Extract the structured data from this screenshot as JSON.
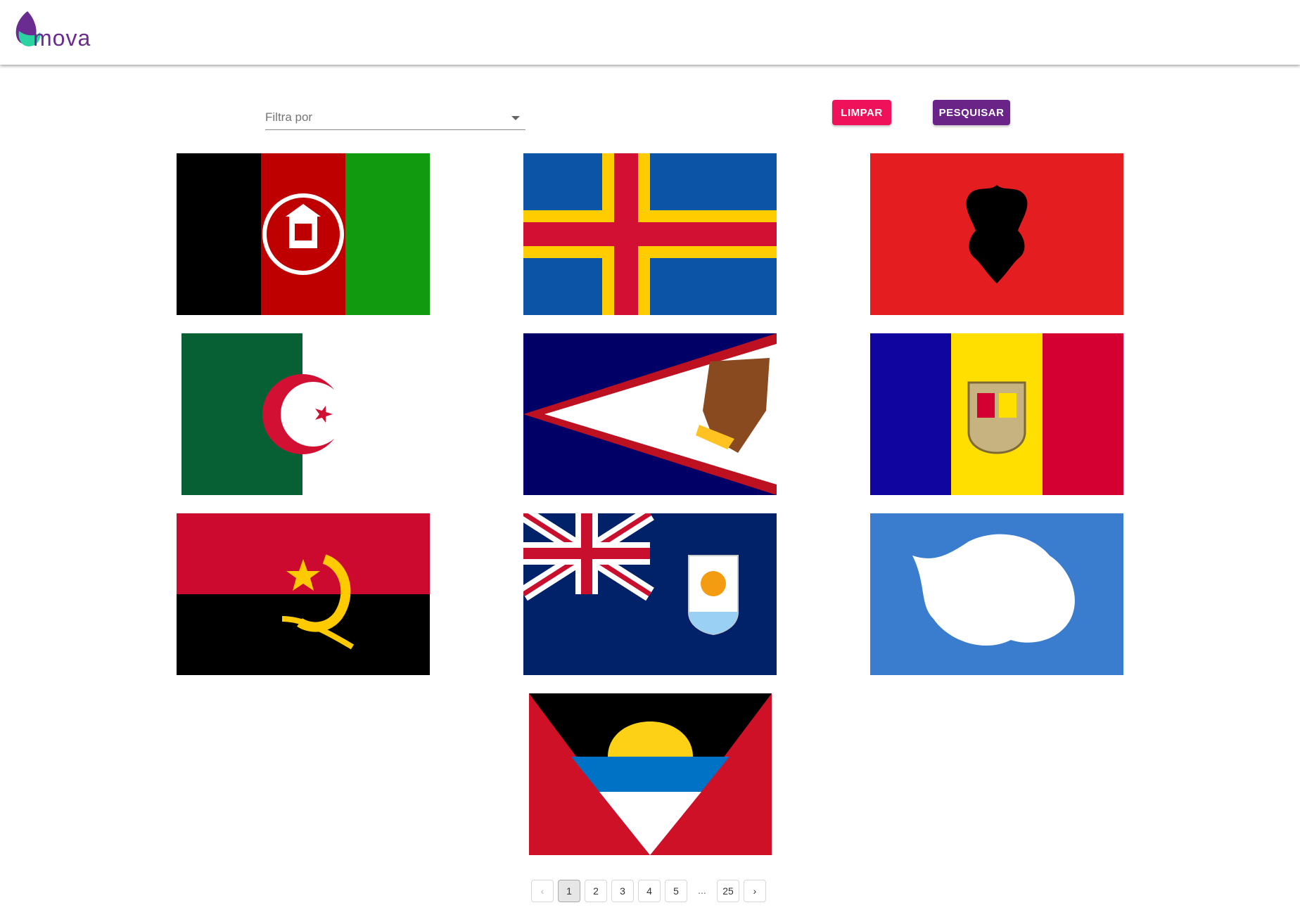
{
  "header": {
    "logo_text": "mova"
  },
  "filter": {
    "label": "Filtra por"
  },
  "buttons": {
    "clear": "LIMPAR",
    "search": "PESQUISAR"
  },
  "colors": {
    "clear_button": "#f0115b",
    "search_button": "#6a2387",
    "logo_accent": "#2bd3a0"
  },
  "flags": [
    {
      "icon": "afghanistan-flag"
    },
    {
      "icon": "aland-islands-flag"
    },
    {
      "icon": "albania-flag"
    },
    {
      "icon": "algeria-flag"
    },
    {
      "icon": "american-samoa-flag"
    },
    {
      "icon": "andorra-flag"
    },
    {
      "icon": "angola-flag"
    },
    {
      "icon": "anguilla-flag"
    },
    {
      "icon": "antarctica-flag"
    },
    {
      "icon": "antigua-and-barbuda-flag"
    }
  ],
  "pagination": {
    "prev": "‹",
    "pages": [
      "1",
      "2",
      "3",
      "4",
      "5"
    ],
    "ellipsis": "...",
    "last": "25",
    "next": "›",
    "current": "1"
  }
}
